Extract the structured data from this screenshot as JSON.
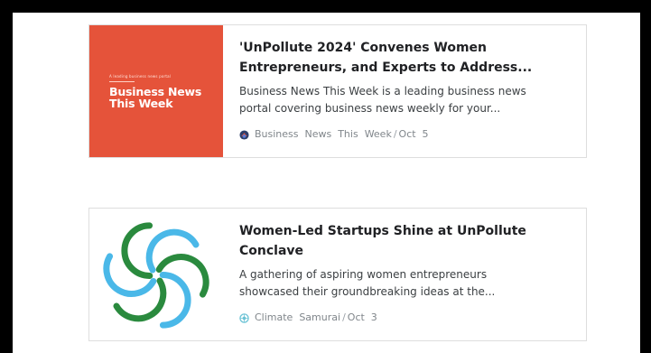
{
  "articles": [
    {
      "thumbnail": {
        "background_color": "#e5533a",
        "tagline": "A leading business news portal",
        "brand": "Business News This Week"
      },
      "title_line1": "'UnPollute 2024' Convenes Women",
      "title_line2": "Entrepreneurs, and Experts to Address...",
      "desc_line1": "Business News This Week is a leading business news",
      "desc_line2": "portal covering business news weekly for your...",
      "source": "Business  News  This  Week",
      "separator": "/",
      "date": "Oct  5",
      "favicon": "business-news-favicon-icon"
    },
    {
      "thumbnail": {
        "logo": "climate-samurai-swirl-logo",
        "colors": [
          "#2a8a3e",
          "#4ab8e8"
        ]
      },
      "title_line1": "Women-Led Startups Shine at UnPollute",
      "title_line2": "Conclave",
      "desc_line1": "A gathering of aspiring women entrepreneurs",
      "desc_line2": "showcased their groundbreaking ideas at the...",
      "source": "Climate  Samurai",
      "separator": "/",
      "date": "Oct  3",
      "favicon": "climate-samurai-favicon-icon"
    }
  ]
}
